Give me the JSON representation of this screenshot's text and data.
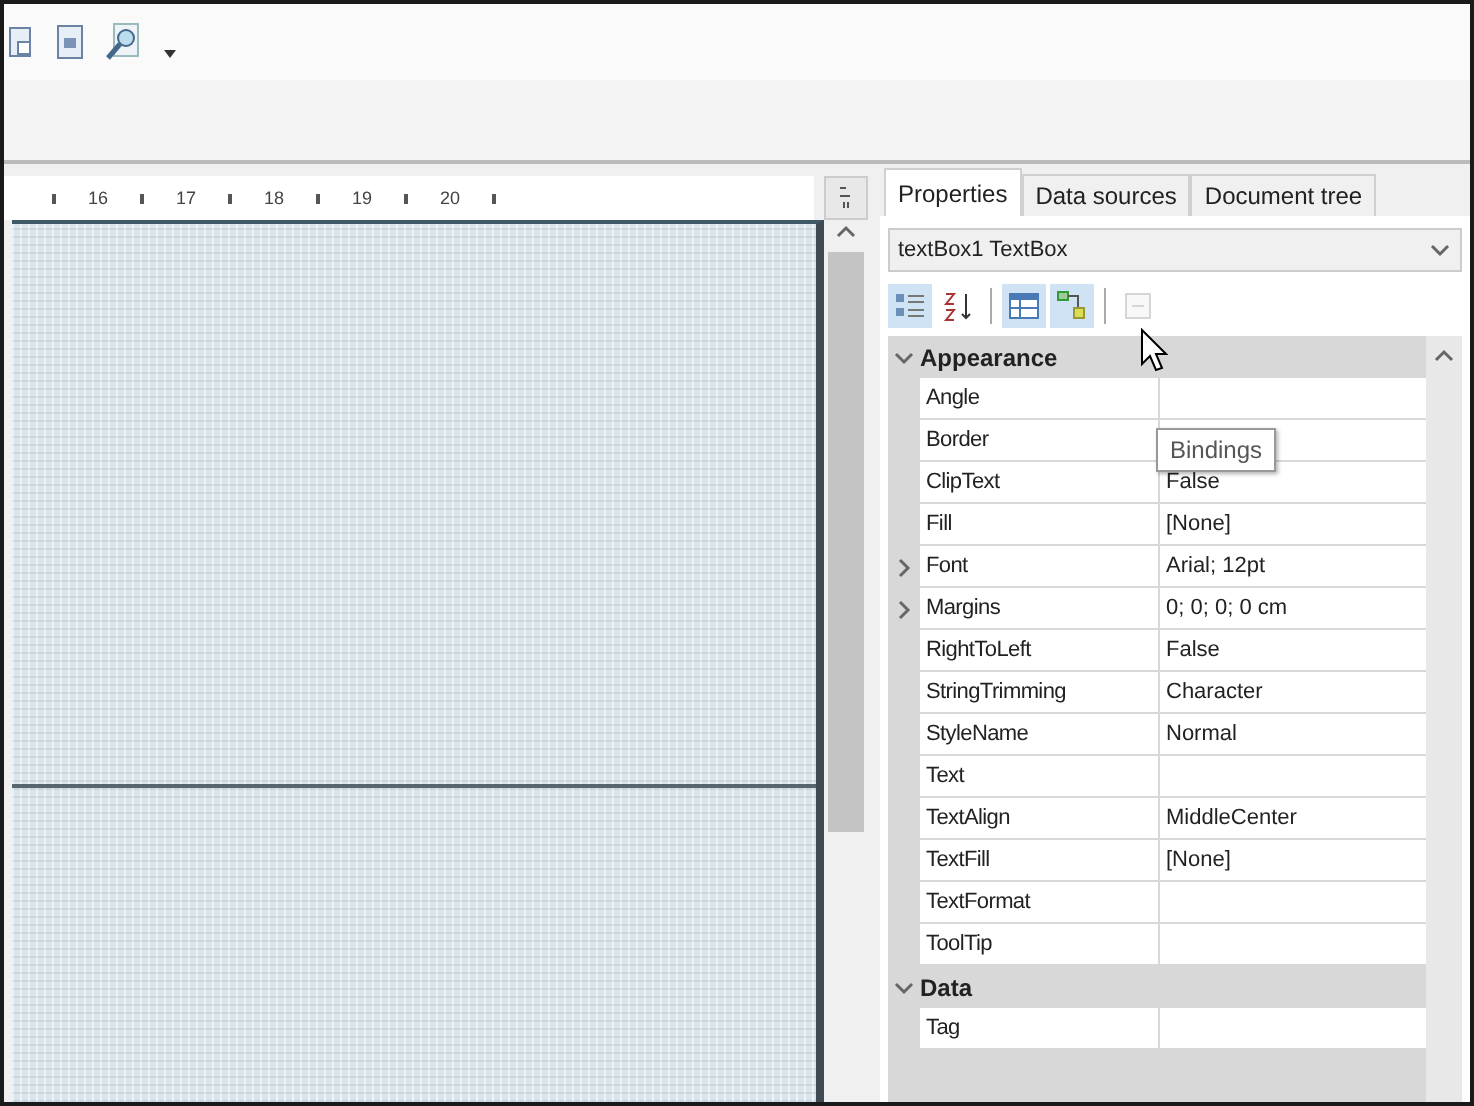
{
  "ruler": {
    "labels": [
      "16",
      "17",
      "18",
      "19",
      "20"
    ]
  },
  "tabs": [
    {
      "label": "Properties",
      "selected": true
    },
    {
      "label": "Data sources",
      "selected": false
    },
    {
      "label": "Document tree",
      "selected": false
    }
  ],
  "object_selector": {
    "value": "textBox1 TextBox"
  },
  "grid_toolbar": [
    {
      "kind": "categorized",
      "selected": true,
      "disabled": false
    },
    {
      "kind": "alphabetical",
      "selected": false,
      "disabled": false
    },
    {
      "kind": "pages",
      "selected": true,
      "disabled": false
    },
    {
      "kind": "bindings",
      "selected": true,
      "disabled": false
    },
    {
      "kind": "events",
      "selected": false,
      "disabled": true
    }
  ],
  "tooltip": "Bindings",
  "property_grid": [
    {
      "category": "Appearance",
      "expanded": true,
      "rows": [
        {
          "name": "Angle",
          "value": "",
          "expandable": false
        },
        {
          "name": "Border",
          "value": "",
          "expandable": false
        },
        {
          "name": "ClipText",
          "value": "False",
          "expandable": false
        },
        {
          "name": "Fill",
          "value": "[None]",
          "expandable": false
        },
        {
          "name": "Font",
          "value": "Arial; 12pt",
          "expandable": true
        },
        {
          "name": "Margins",
          "value": "0; 0; 0; 0 cm",
          "expandable": true
        },
        {
          "name": "RightToLeft",
          "value": "False",
          "expandable": false
        },
        {
          "name": "StringTrimming",
          "value": "Character",
          "expandable": false
        },
        {
          "name": "StyleName",
          "value": "Normal",
          "expandable": false
        },
        {
          "name": "Text",
          "value": "",
          "expandable": false
        },
        {
          "name": "TextAlign",
          "value": "MiddleCenter",
          "expandable": false
        },
        {
          "name": "TextFill",
          "value": "[None]",
          "expandable": false
        },
        {
          "name": "TextFormat",
          "value": "",
          "expandable": false
        },
        {
          "name": "ToolTip",
          "value": "",
          "expandable": false
        }
      ]
    },
    {
      "category": "Data",
      "expanded": true,
      "rows": [
        {
          "name": "Tag",
          "value": "",
          "expandable": false
        }
      ]
    }
  ]
}
